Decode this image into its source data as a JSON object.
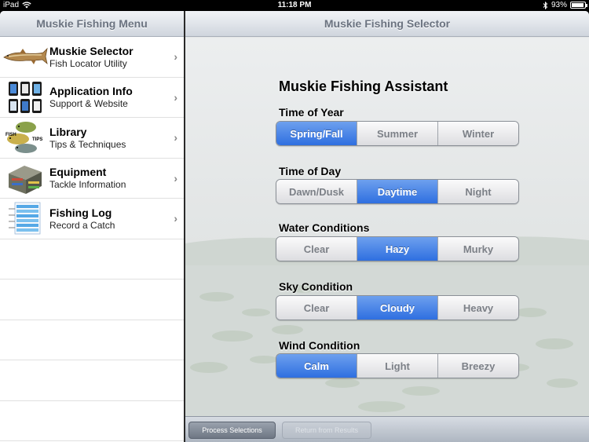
{
  "status_bar": {
    "carrier": "iPad",
    "time": "11:18 PM",
    "battery_text": "93%",
    "battery_level": 0.93
  },
  "left_pane": {
    "title": "Muskie Fishing Menu",
    "items": [
      {
        "title": "Muskie Selector",
        "subtitle": "Fish Locator Utility",
        "icon": "muskie-fish-image"
      },
      {
        "title": "Application Info",
        "subtitle": "Support & Website",
        "icon": "app-screens-image"
      },
      {
        "title": "Library",
        "subtitle": "Tips & Techniques",
        "icon": "fish-tips-image"
      },
      {
        "title": "Equipment",
        "subtitle": "Tackle Information",
        "icon": "tackle-box-image"
      },
      {
        "title": "Fishing Log",
        "subtitle": "Record a Catch",
        "icon": "log-sheet-image"
      }
    ],
    "chevron": "›"
  },
  "right_pane": {
    "title": "Muskie Fishing Selector",
    "assistant_title": "Muskie Fishing Assistant",
    "groups": [
      {
        "label": "Time of Year",
        "options": [
          "Spring/Fall",
          "Summer",
          "Winter"
        ],
        "selected": "Spring/Fall"
      },
      {
        "label": "Time of Day",
        "options": [
          "Dawn/Dusk",
          "Daytime",
          "Night"
        ],
        "selected": "Daytime"
      },
      {
        "label": "Water Conditions",
        "options": [
          "Clear",
          "Hazy",
          "Murky"
        ],
        "selected": "Hazy"
      },
      {
        "label": "Sky Condition",
        "options": [
          "Clear",
          "Cloudy",
          "Heavy"
        ],
        "selected": "Cloudy"
      },
      {
        "label": "Wind Condition",
        "options": [
          "Calm",
          "Light",
          "Breezy"
        ],
        "selected": "Calm"
      }
    ],
    "toolbar": {
      "process_label": "Process Selections",
      "return_label": "Return from Results"
    }
  },
  "colors": {
    "selected_segment": "#3a78e4",
    "nav_title": "#6b7380"
  }
}
